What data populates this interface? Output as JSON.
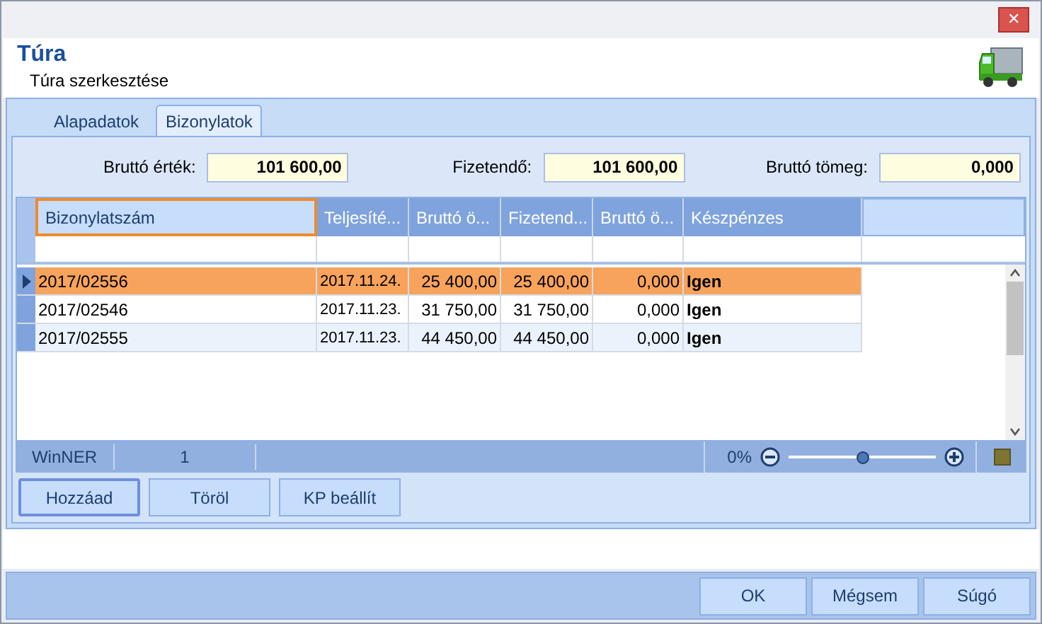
{
  "window": {
    "close": "✕"
  },
  "header": {
    "title": "Túra",
    "subtitle": "Túra szerkesztése"
  },
  "tabs": [
    {
      "label": "Alapadatok",
      "selected": false
    },
    {
      "label": "Bizonylatok",
      "selected": true
    }
  ],
  "totals": [
    {
      "label": "Bruttó érték:",
      "value": "101 600,00"
    },
    {
      "label": "Fizetendő:",
      "value": "101 600,00"
    },
    {
      "label": "Bruttó tömeg:",
      "value": "0,000"
    }
  ],
  "table": {
    "columns": [
      {
        "label": "Bizonylatszám",
        "selected": true
      },
      {
        "label": "Teljesíté...",
        "selected": false
      },
      {
        "label": "Bruttó ö...",
        "selected": false
      },
      {
        "label": "Fizetend...",
        "selected": false
      },
      {
        "label": "Bruttó ö...",
        "selected": false
      },
      {
        "label": "Készpénzes",
        "selected": false
      }
    ],
    "rows": [
      {
        "selected": true,
        "cells": [
          "2017/02556",
          "2017.11.24.",
          "25 400,00",
          "25 400,00",
          "0,000",
          "Igen"
        ]
      },
      {
        "selected": false,
        "cells": [
          "2017/02546",
          "2017.11.23.",
          "31 750,00",
          "31 750,00",
          "0,000",
          "Igen"
        ]
      },
      {
        "selected": false,
        "cells": [
          "2017/02555",
          "2017.11.23.",
          "44 450,00",
          "44 450,00",
          "0,000",
          "Igen"
        ]
      }
    ]
  },
  "status_bar": {
    "user": "WinNER",
    "count": "1",
    "zoom_reading": "0%",
    "zoom": {
      "level": 0.5
    }
  },
  "actions": [
    {
      "label": "Hozzáad",
      "selected": true
    },
    {
      "label": "Töröl",
      "selected": false
    },
    {
      "label": "KP beállít",
      "selected": false
    }
  ],
  "buttons": [
    "OK",
    "Mégsem",
    "Súgó"
  ]
}
